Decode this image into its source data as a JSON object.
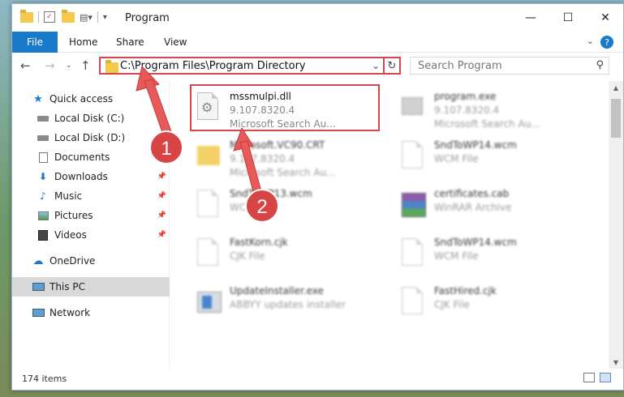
{
  "window": {
    "title": "Program",
    "controls": [
      "minimize",
      "maximize",
      "close"
    ]
  },
  "ribbon": {
    "tabs": [
      {
        "label": "File",
        "active": true
      },
      {
        "label": "Home"
      },
      {
        "label": "Share"
      },
      {
        "label": "View"
      }
    ],
    "help_label": "?"
  },
  "navigation": {
    "address": "C:\\Program Files\\Program Directory",
    "search_placeholder": "Search Program"
  },
  "sidebar": {
    "items": [
      {
        "label": "Quick access",
        "icon": "star-icon"
      },
      {
        "label": "Local Disk (C:)",
        "icon": "drive-icon",
        "pinned": true
      },
      {
        "label": "Local Disk (D:)",
        "icon": "drive-icon"
      },
      {
        "label": "Documents",
        "icon": "documents-icon"
      },
      {
        "label": "Downloads",
        "icon": "downloads-icon",
        "pinned": true
      },
      {
        "label": "Music",
        "icon": "music-icon",
        "pinned": true
      },
      {
        "label": "Pictures",
        "icon": "pictures-icon",
        "pinned": true
      },
      {
        "label": "Videos",
        "icon": "videos-icon",
        "pinned": true
      },
      {
        "label": "OneDrive",
        "icon": "cloud-icon"
      },
      {
        "label": "This PC",
        "icon": "computer-icon",
        "selected": true
      },
      {
        "label": "Network",
        "icon": "network-icon"
      }
    ]
  },
  "files": [
    {
      "name": "mssmulpi.dll",
      "line1": "9.107.8320.4",
      "line2": "Microsoft Search Au...",
      "icon": "dll-gear-icon",
      "highlighted": true
    },
    {
      "name": "program.exe",
      "line1": "9.107.8320.4",
      "line2": "Microsoft Search Au...",
      "icon": "exe-icon"
    },
    {
      "name": "Microsoft.VC90.CRT",
      "line1": "9.107.8320.4",
      "line2": "Microsoft Search Au...",
      "icon": "folder-icon"
    },
    {
      "name": "SndToWP14.wcm",
      "line1": "WCM File",
      "line2": "",
      "icon": "file-icon"
    },
    {
      "name": "SndToWP13.wcm",
      "line1": "WCM File",
      "line2": "",
      "icon": "file-icon"
    },
    {
      "name": "certificates.cab",
      "line1": "WinRAR Archive",
      "line2": "",
      "icon": "winrar-icon"
    },
    {
      "name": "FastKorn.cjk",
      "line1": "CJK File",
      "line2": "",
      "icon": "file-icon"
    },
    {
      "name": "SndToWP14.wcm",
      "line1": "WCM File",
      "line2": "",
      "icon": "file-icon"
    },
    {
      "name": "UpdateInstaller.exe",
      "line1": "ABBYY updates installer",
      "line2": "",
      "icon": "installer-icon"
    },
    {
      "name": "FastHired.cjk",
      "line1": "CJK File",
      "line2": "",
      "icon": "file-icon"
    }
  ],
  "status": {
    "item_count": "174 items"
  },
  "annotations": [
    {
      "label": "1"
    },
    {
      "label": "2"
    }
  ],
  "colors": {
    "accent": "#1979ca",
    "highlight": "#d6464a"
  }
}
